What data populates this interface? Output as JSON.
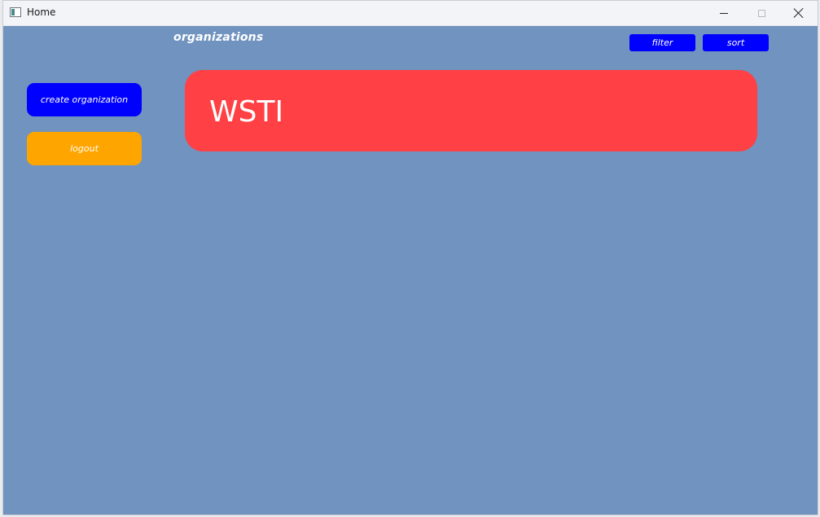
{
  "window": {
    "title": "Home",
    "app_icon": "app-window-icon",
    "controls": {
      "minimize_icon": "minimize-icon",
      "maximize_icon": "maximize-icon",
      "close_icon": "close-icon"
    }
  },
  "header": {
    "title": "organizations",
    "filter_label": "filter",
    "sort_label": "sort"
  },
  "sidebar": {
    "create_label": "create organization",
    "logout_label": "logout"
  },
  "organizations": [
    {
      "name": "WSTI"
    }
  ],
  "colors": {
    "background": "#7093bf",
    "primary_button": "#0000ff",
    "logout_button": "#ffa500",
    "card": "#ff4044",
    "text": "#ffffff"
  }
}
